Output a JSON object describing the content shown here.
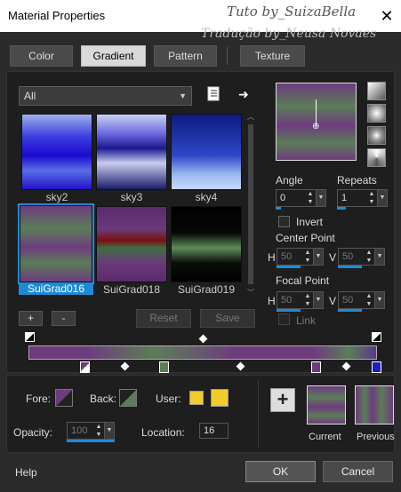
{
  "window": {
    "title": "Material Properties",
    "close_glyph": "✕",
    "watermark_line1": "Tuto by_SuizaBella",
    "watermark_line2": "Tradução by_Neusa Novaes"
  },
  "tabs": [
    {
      "label": "Color",
      "active": false
    },
    {
      "label": "Gradient",
      "active": true
    },
    {
      "label": "Pattern",
      "active": false
    },
    {
      "label": "Texture",
      "active": false
    }
  ],
  "library": {
    "filter_value": "All",
    "icons": {
      "document": "document-icon",
      "arrow": "arrow-right-icon"
    },
    "items": [
      {
        "name": "sky2",
        "selected": false
      },
      {
        "name": "sky3",
        "selected": false
      },
      {
        "name": "sky4",
        "selected": false
      },
      {
        "name": "SuiGrad016",
        "selected": true
      },
      {
        "name": "SuiGrad018",
        "selected": false
      },
      {
        "name": "SuiGrad019",
        "selected": false
      }
    ],
    "buttons": {
      "add": "+",
      "remove": "-",
      "reset": "Reset",
      "save": "Save"
    }
  },
  "controls": {
    "angle_label": "Angle",
    "angle_value": "0",
    "repeats_label": "Repeats",
    "repeats_value": "1",
    "invert_label": "Invert",
    "center_label": "Center Point",
    "center_h_label": "H",
    "center_h": "50",
    "center_v_label": "V",
    "center_v": "50",
    "focal_label": "Focal Point",
    "focal_h_label": "H",
    "focal_h": "50",
    "focal_v_label": "V",
    "focal_v": "50",
    "link_label": "Link"
  },
  "bottom": {
    "fore_label": "Fore:",
    "back_label": "Back:",
    "user_label": "User:",
    "opacity_label": "Opacity:",
    "opacity_value": "100",
    "location_label": "Location:",
    "location_value": "16",
    "current_label": "Current",
    "previous_label": "Previous",
    "add_glyph": "+",
    "user_color": "#f2cc2b"
  },
  "footer": {
    "help_label": "Help",
    "ok_label": "OK",
    "cancel_label": "Cancel"
  }
}
